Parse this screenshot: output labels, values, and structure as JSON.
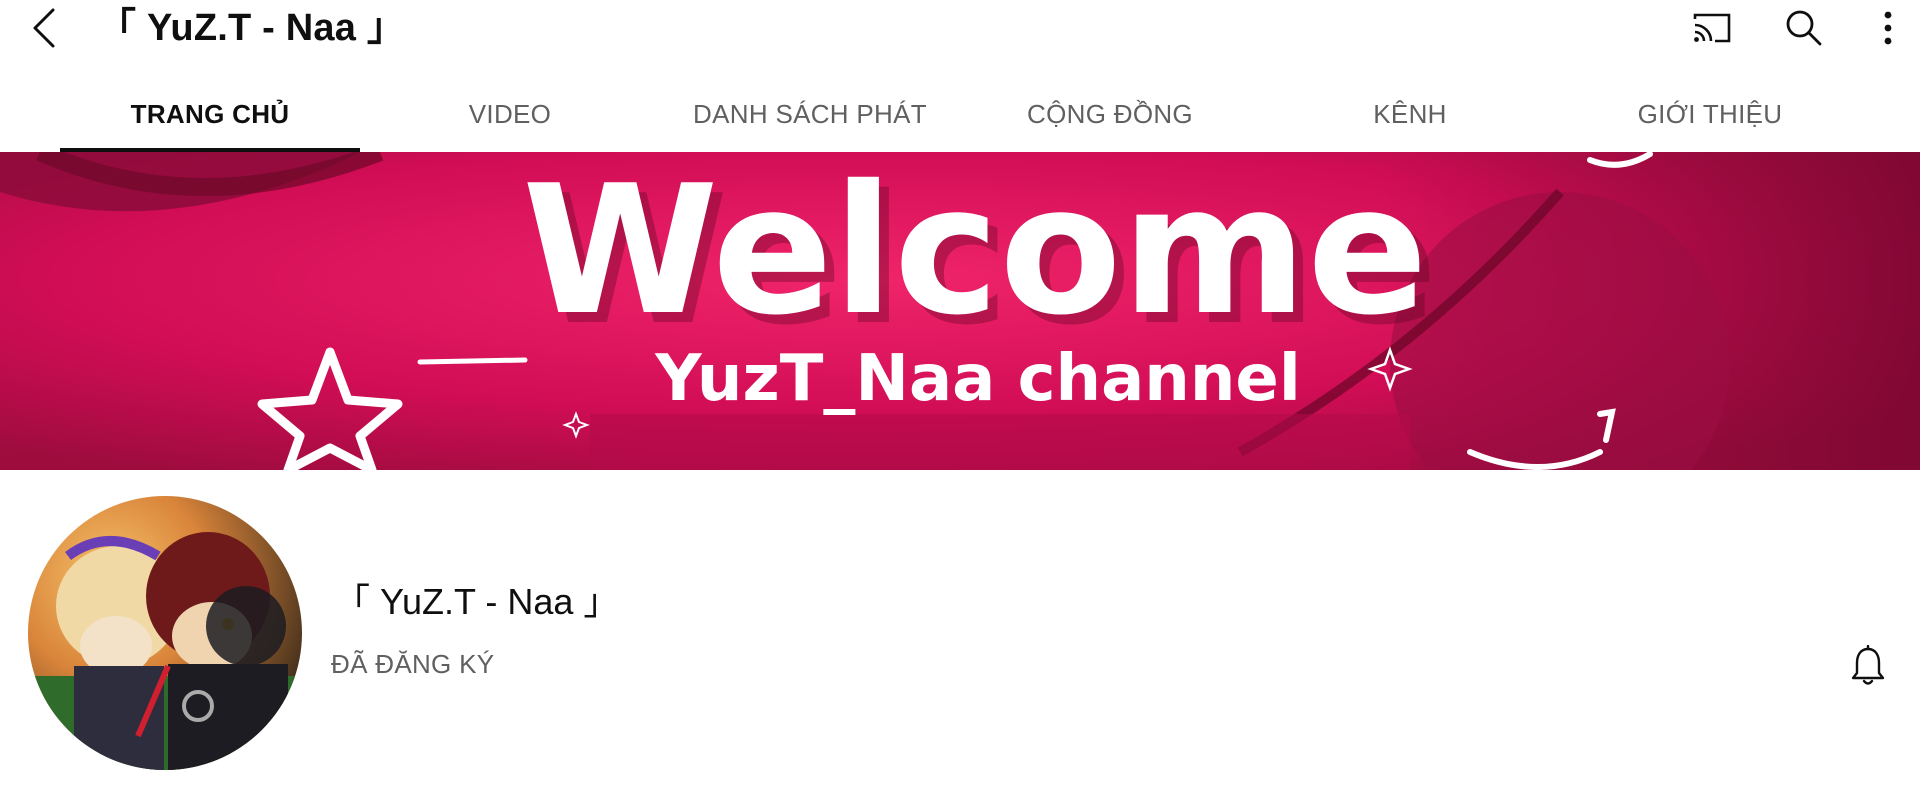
{
  "header": {
    "title": "「 YuZ.T - Naa 」",
    "icons": {
      "back": "chevron-left-icon",
      "cast": "cast-icon",
      "search": "search-icon",
      "more": "more-vertical-icon"
    }
  },
  "tabs": [
    {
      "label": "TRANG CHỦ",
      "active": true
    },
    {
      "label": "VIDEO",
      "active": false
    },
    {
      "label": "DANH SÁCH PHÁT",
      "active": false
    },
    {
      "label": "CỘNG ĐỒNG",
      "active": false
    },
    {
      "label": "KÊNH",
      "active": false
    },
    {
      "label": "GIỚI THIỆU",
      "active": false
    }
  ],
  "banner": {
    "headline": "Welcome",
    "subline": "YuzT_Naa channel",
    "colors": {
      "primary": "#e8115f",
      "dark": "#8a0a36",
      "text": "#ffffff"
    }
  },
  "channel": {
    "name": "「 YuZ.T - Naa 」",
    "subscribe_status": "ĐÃ ĐĂNG KÝ",
    "icons": {
      "notification": "bell-icon"
    }
  },
  "colors": {
    "text_primary": "#0f0f0f",
    "text_secondary": "#606060",
    "indicator": "#0f0f0f"
  }
}
